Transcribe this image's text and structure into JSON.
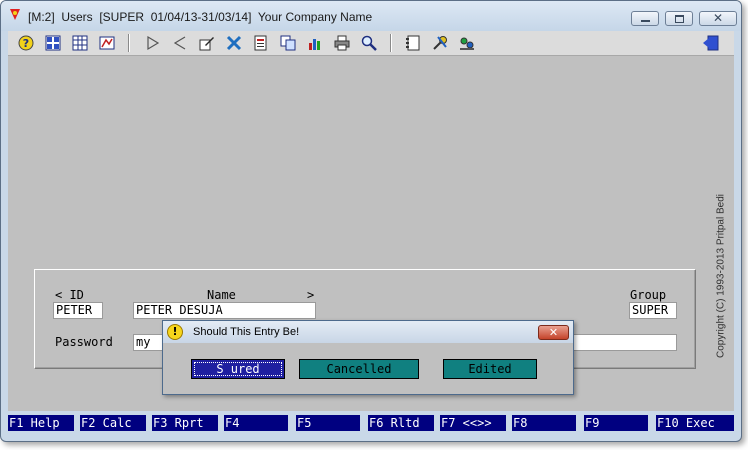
{
  "window": {
    "title": "[M:2]  Users  [SUPER  01/04/13-31/03/14]  Your Company Name",
    "controls": {
      "close_glyph": "✕"
    }
  },
  "toolbar": {
    "icons": [
      "help-icon",
      "grid-icon",
      "table-icon",
      "report-icon",
      "next-icon",
      "previous-icon",
      "edit-icon",
      "delete-icon",
      "new-icon",
      "copy-icon",
      "chart-icon",
      "print-icon",
      "search-icon",
      "notes-icon",
      "tools-icon",
      "settings-icon",
      "exit-icon"
    ]
  },
  "copyright": "Copyright  (C)  1993-2013  Pritpal Bedi",
  "form": {
    "id_label": "< ID",
    "name_label": "Name",
    "nav_right": ">",
    "group_label": "Group",
    "password_label": "Password",
    "id_value": "PETER",
    "name_value": "PETER DESUJA",
    "group_value": "SUPER",
    "password_value": "my"
  },
  "dialog": {
    "title": "Should This Entry Be!",
    "icon_glyph": "!",
    "close_glyph": "✕",
    "buttons": {
      "sure": "S ured",
      "cancelled": "Cancelled",
      "edited": "Edited"
    }
  },
  "fkeys": [
    "F1 Help",
    "F2 Calc",
    "F3 Rprt",
    "F4",
    "F5",
    "F6 Rltd",
    "F7 <<>>",
    "F8",
    "F9",
    "F10 Exec"
  ],
  "colors": {
    "fkey_bg": "#000080",
    "dialog_sure_bg": "#1f1fa0",
    "dialog_btn_bg": "#108080",
    "client_bg": "#c0c0c0",
    "titlebar": "#c9d8e8"
  }
}
